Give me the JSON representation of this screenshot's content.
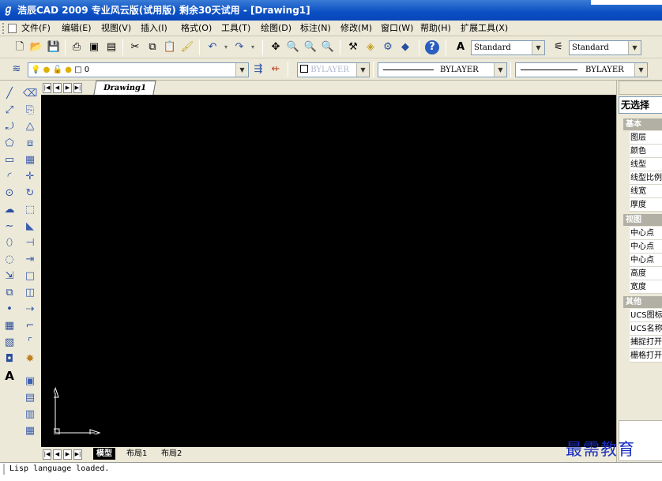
{
  "window": {
    "title": "浩辰CAD 2009 专业风云版(试用版) 剩余30天试用 - [Drawing1]"
  },
  "menu": {
    "items": [
      {
        "label": "文件(F)"
      },
      {
        "label": "编辑(E)"
      },
      {
        "label": "视图(V)"
      },
      {
        "label": "插入(I)"
      },
      {
        "label": "格式(O)"
      },
      {
        "label": "工具(T)"
      },
      {
        "label": "绘图(D)"
      },
      {
        "label": "标注(N)"
      },
      {
        "label": "修改(M)"
      },
      {
        "label": "窗口(W)"
      },
      {
        "label": "帮助(H)"
      },
      {
        "label": "扩展工具(X)"
      }
    ]
  },
  "toolbar": {
    "text_style": "Standard",
    "dim_style": "Standard",
    "layer": "0",
    "color": "BYLAYER",
    "linetype": "BYLAYER",
    "lineweight": "BYLAYER"
  },
  "drawing_tabs": {
    "top_tab": "Drawing1",
    "bottom_tabs": [
      {
        "label": "模型",
        "active": true
      },
      {
        "label": "布局1",
        "active": false
      },
      {
        "label": "布局2",
        "active": false
      }
    ]
  },
  "ucs": {
    "x_label": "X",
    "y_label": "Y"
  },
  "properties": {
    "selection": "无选择",
    "sections": [
      {
        "title": "基本",
        "rows": [
          "图层",
          "颜色",
          "线型",
          "线型比例",
          "线宽",
          "厚度"
        ]
      },
      {
        "title": "视图",
        "rows": [
          "中心点",
          "中心点",
          "中心点",
          "高度",
          "宽度"
        ]
      },
      {
        "title": "其他",
        "rows": [
          "UCS图标",
          "UCS名称",
          "捕捉打开",
          "栅格打开"
        ]
      }
    ]
  },
  "status": {
    "command_text": "Lisp language loaded."
  },
  "watermark": {
    "text": "最需教育"
  }
}
